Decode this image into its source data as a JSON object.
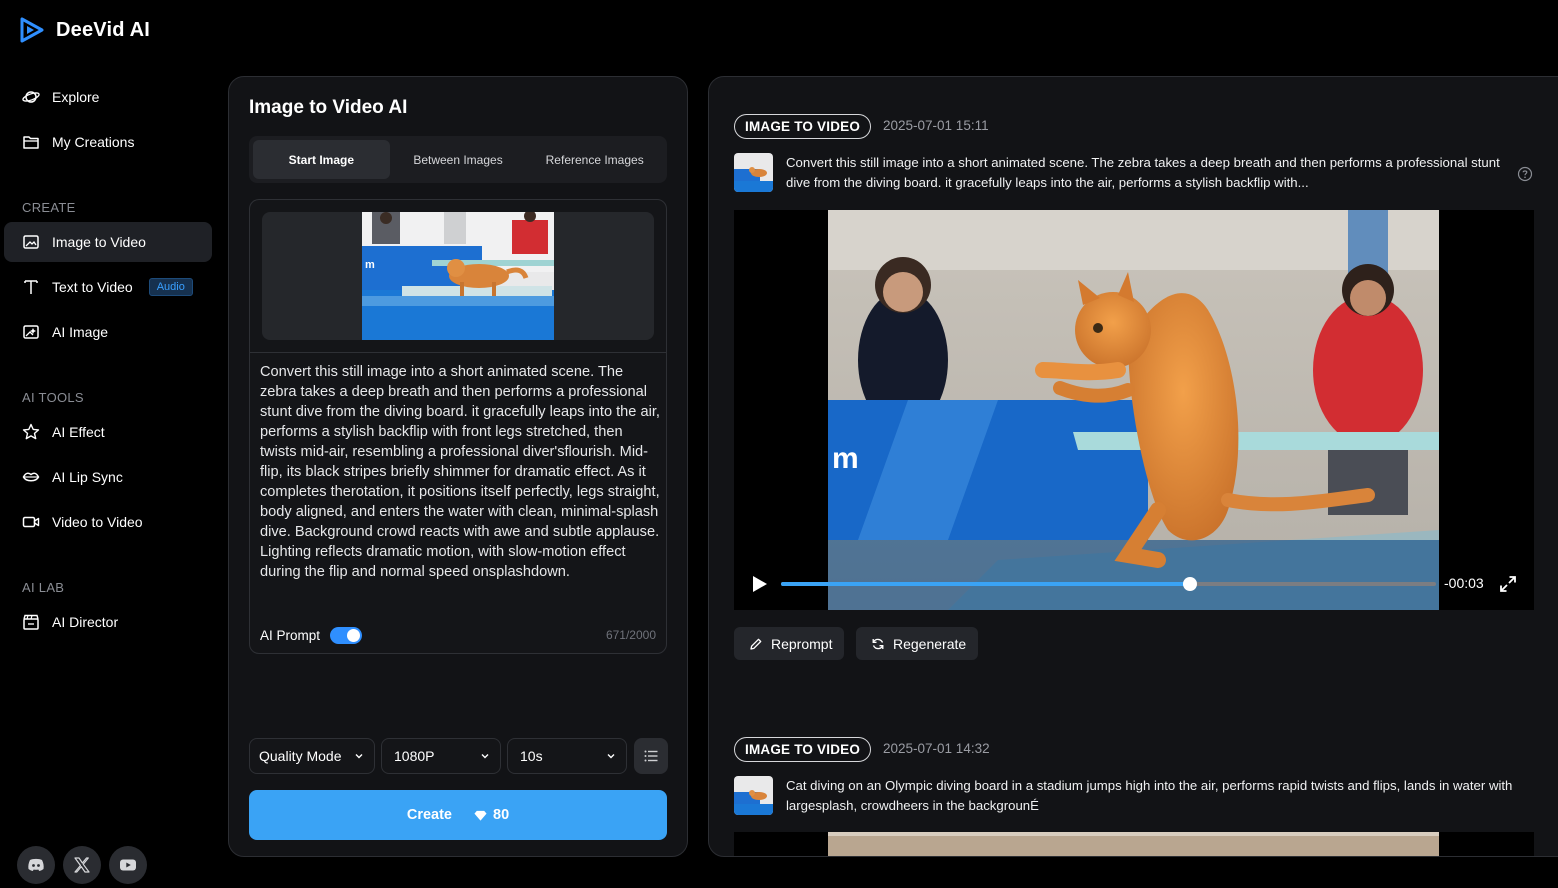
{
  "app": {
    "name": "DeeVid AI",
    "accent": "#3aa3f5"
  },
  "sidebar": {
    "top_items": [
      {
        "label": "Explore",
        "icon": "planet-icon"
      },
      {
        "label": "My Creations",
        "icon": "folder-icon"
      }
    ],
    "sections": {
      "create": "CREATE",
      "ai_tools": "AI TOOLS",
      "ai_lab": "AI LAB"
    },
    "create_items": [
      {
        "label": "Image to Video",
        "icon": "image-icon",
        "active": true
      },
      {
        "label": "Text to Video",
        "icon": "text-icon",
        "badge": "Audio"
      },
      {
        "label": "AI Image",
        "icon": "ai-image-icon"
      }
    ],
    "tool_items": [
      {
        "label": "AI Effect",
        "icon": "star-icon"
      },
      {
        "label": "AI Lip Sync",
        "icon": "lips-icon"
      },
      {
        "label": "Video to Video",
        "icon": "video-camera-icon"
      }
    ],
    "lab_items": [
      {
        "label": "AI Director",
        "icon": "clapperboard-icon"
      }
    ],
    "social": [
      "discord-icon",
      "x-icon",
      "youtube-icon"
    ]
  },
  "generator": {
    "title": "Image to Video AI",
    "tabs": [
      "Start Image",
      "Between Images",
      "Reference Images"
    ],
    "active_tab": "Start Image",
    "prompt": "Convert this still image into a short animated scene. The zebra takes a deep breath and then performs a professional stunt dive from the diving board. it gracefully leaps into the air, performs a stylish backflip with front legs stretched, then twists mid-air, resembling a professional diver'sflourish. Mid-flip, its black stripes briefly shimmer for dramatic effect. As it completes therotation, it positions itself perfectly, legs straight, body aligned, and enters the water with clean, minimal-splash dive. Background crowd reacts with awe and subtle applause. Lighting reflects dramatic motion, with slow-motion effect during the flip and normal speed onsplashdown.",
    "ai_prompt_label": "AI Prompt",
    "ai_prompt_on": true,
    "char_count": "671/2000",
    "mode": "Quality Mode",
    "resolution": "1080P",
    "duration": "10s",
    "create_label": "Create",
    "cost": "80"
  },
  "history": [
    {
      "tag": "IMAGE TO VIDEO",
      "timestamp": "2025-07-01 15:11",
      "prompt": "Convert this still image into a short animated scene. The zebra takes a deep breath and then performs a professional stunt dive from the diving board. it gracefully leaps into the air, performs a stylish backflip with...",
      "player": {
        "time_remaining": "-00:03",
        "progress": 0.625
      },
      "actions": {
        "reprompt": "Reprompt",
        "regenerate": "Regenerate"
      }
    },
    {
      "tag": "IMAGE TO VIDEO",
      "timestamp": "2025-07-01 14:32",
      "prompt": "Cat diving on an Olympic diving board in a stadium jumps high into the air, performs rapid twists and flips, lands in water with largesplash, crowdheers in the backgrounÉ"
    }
  ]
}
